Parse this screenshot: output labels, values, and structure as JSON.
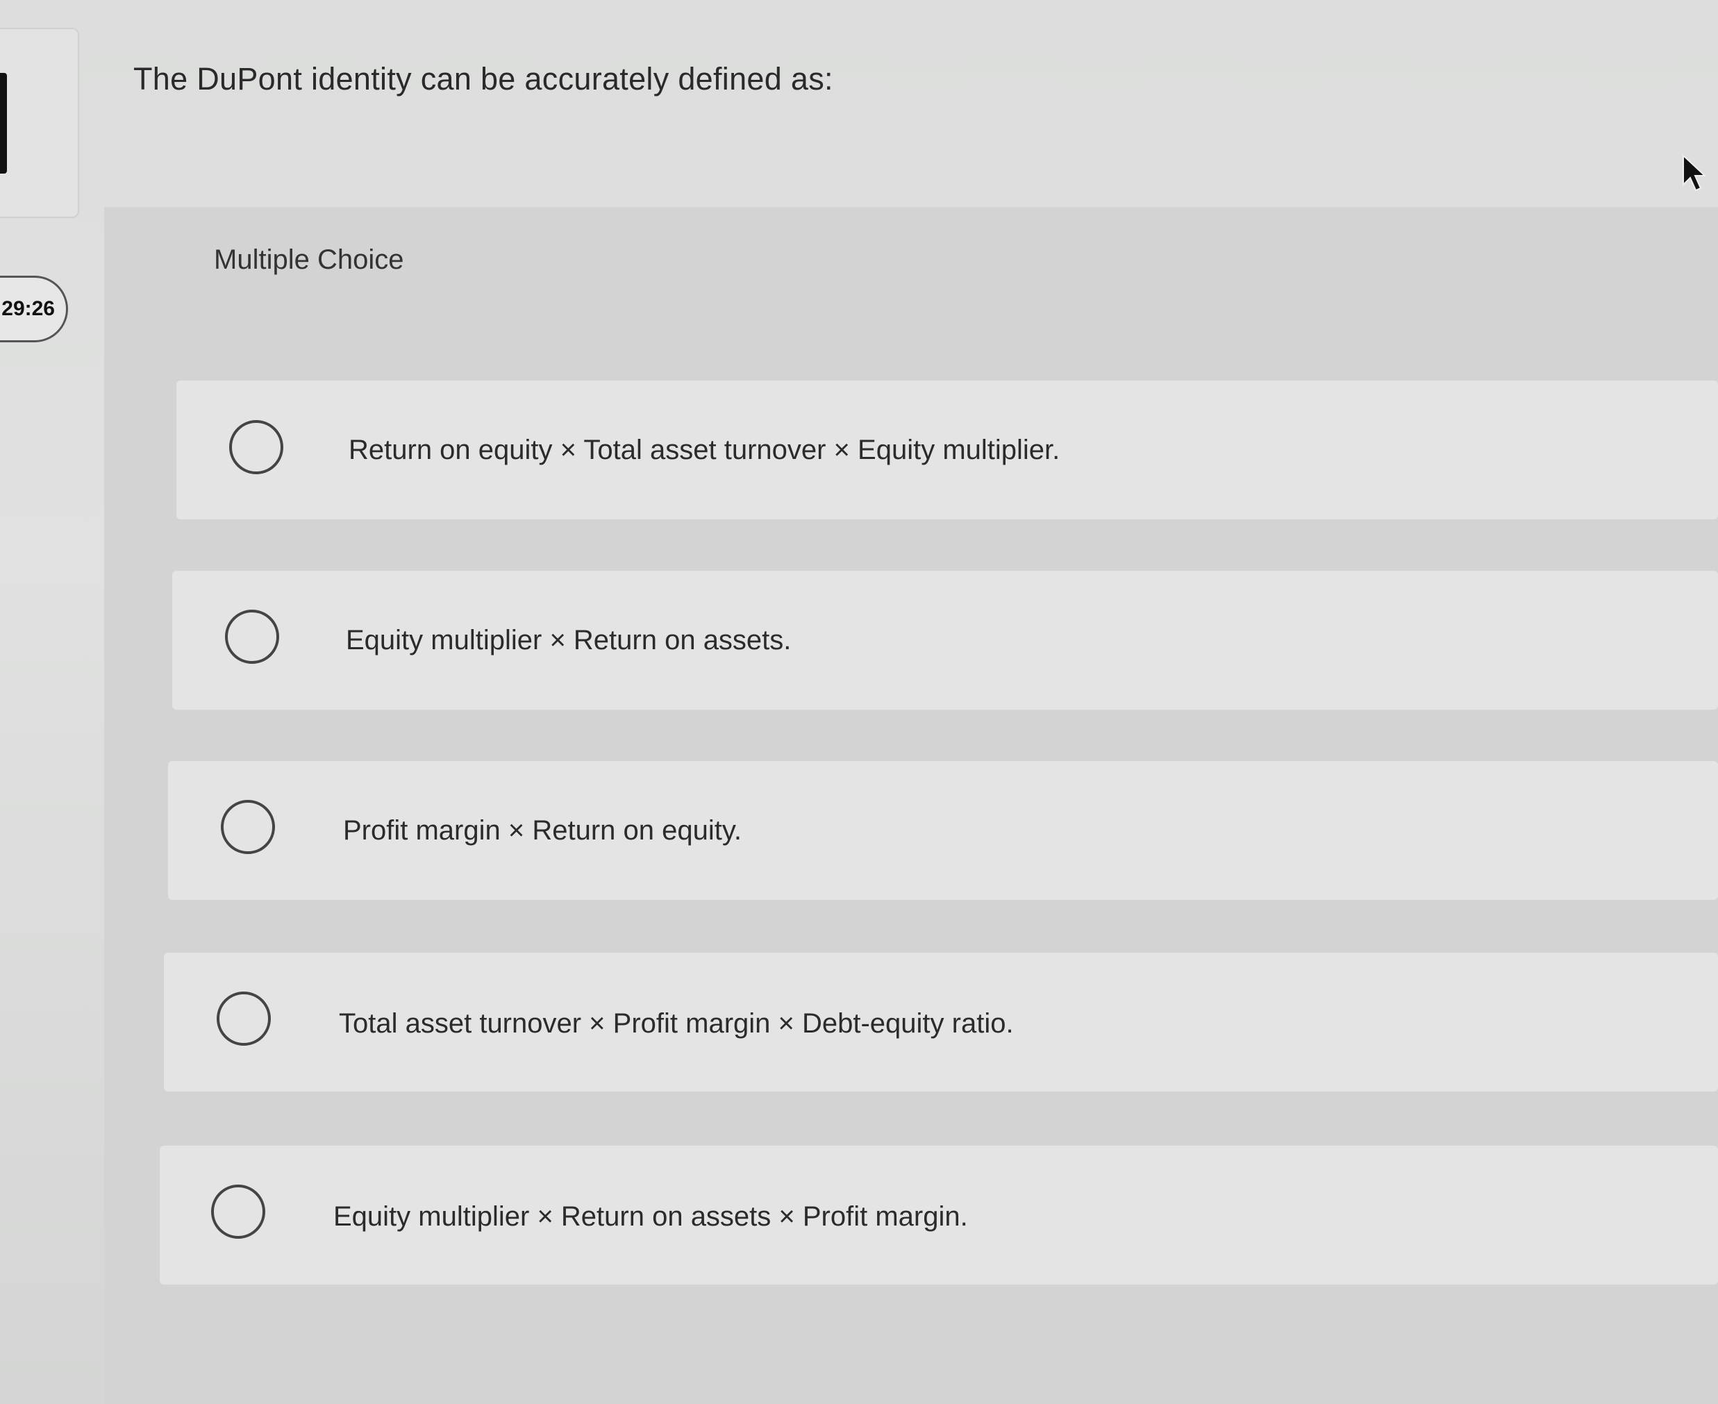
{
  "timer": {
    "text": "29:26"
  },
  "question": {
    "text": "The DuPont identity can be accurately defined as:"
  },
  "answer_section": {
    "label": "Multiple Choice",
    "options": [
      {
        "text": "Return on equity × Total asset turnover × Equity multiplier.",
        "selected": false
      },
      {
        "text": "Equity multiplier × Return on assets.",
        "selected": false
      },
      {
        "text": "Profit margin × Return on equity.",
        "selected": false
      },
      {
        "text": "Total asset turnover × Profit margin × Debt-equity ratio.",
        "selected": false
      },
      {
        "text": "Equity multiplier × Return on assets × Profit margin.",
        "selected": false
      }
    ]
  },
  "icons": {
    "cursor": "mouse-pointer-icon",
    "radio": "radio-button-icon"
  }
}
